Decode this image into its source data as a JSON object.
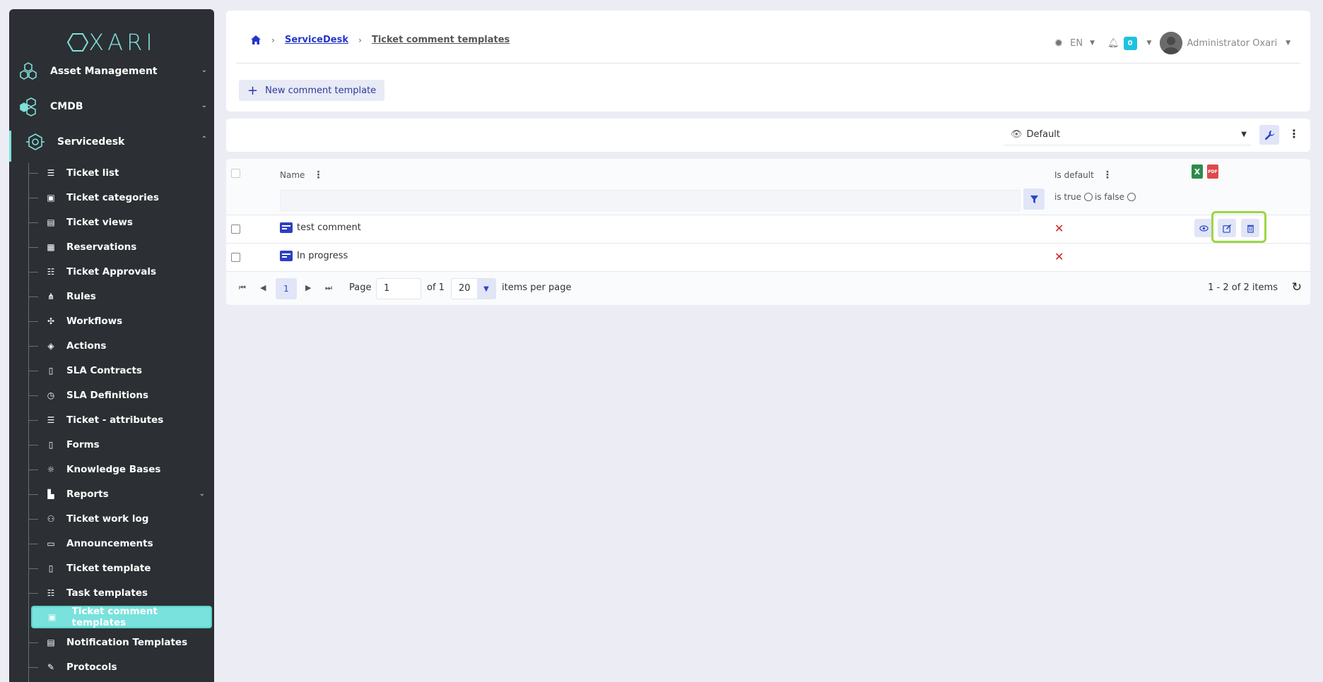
{
  "brand": {
    "logo_text": "XARI",
    "logo_prefix": "O"
  },
  "sidebar": {
    "main_items": [
      {
        "label": "Asset Management",
        "icon": "molecule-icon"
      },
      {
        "label": "CMDB",
        "icon": "hexagon-cluster-icon"
      },
      {
        "label": "Servicedesk",
        "icon": "servicedesk-icon"
      }
    ],
    "sub_items": [
      {
        "label": "Ticket list",
        "icon": "list-icon"
      },
      {
        "label": "Ticket categories",
        "icon": "categories-icon"
      },
      {
        "label": "Ticket views",
        "icon": "table-icon"
      },
      {
        "label": "Reservations",
        "icon": "calendar-icon"
      },
      {
        "label": "Ticket Approvals",
        "icon": "checklist-icon"
      },
      {
        "label": "Rules",
        "icon": "rules-icon"
      },
      {
        "label": "Workflows",
        "icon": "workflow-icon"
      },
      {
        "label": "Actions",
        "icon": "actions-icon"
      },
      {
        "label": "SLA Contracts",
        "icon": "document-icon"
      },
      {
        "label": "SLA Definitions",
        "icon": "stopwatch-icon"
      },
      {
        "label": "Ticket - attributes",
        "icon": "list-icon"
      },
      {
        "label": "Forms",
        "icon": "document-icon"
      },
      {
        "label": "Knowledge Bases",
        "icon": "lightbulb-icon"
      },
      {
        "label": "Reports",
        "icon": "chart-icon"
      },
      {
        "label": "Ticket work log",
        "icon": "user-clock-icon"
      },
      {
        "label": "Announcements",
        "icon": "announcement-icon"
      },
      {
        "label": "Ticket template",
        "icon": "document-icon"
      },
      {
        "label": "Task templates",
        "icon": "checklist-icon"
      },
      {
        "label": "Ticket comment templates",
        "icon": "comment-template-icon"
      },
      {
        "label": "Notification Templates",
        "icon": "notification-template-icon"
      },
      {
        "label": "Protocols",
        "icon": "protocol-icon"
      }
    ]
  },
  "header": {
    "breadcrumb": {
      "section": "ServiceDesk",
      "current": "Ticket comment templates"
    },
    "language": "EN",
    "notification_count": "0",
    "user_name": "Administrator Oxari",
    "new_button_label": "New comment template"
  },
  "view_bar": {
    "selected_view": "Default"
  },
  "table": {
    "columns": {
      "name": "Name",
      "is_default": "Is default"
    },
    "filter": {
      "is_true": "is true",
      "is_false": "is false"
    },
    "export": {
      "excel": "X",
      "pdf": "PDF"
    },
    "rows": [
      {
        "name": "test comment",
        "is_default": "✕"
      },
      {
        "name": "In progress",
        "is_default": "✕"
      }
    ]
  },
  "pager": {
    "current_page": "1",
    "page_label": "Page",
    "page_value": "1",
    "of_label": "of 1",
    "per_page": "20",
    "per_page_label": "items per page",
    "count_text": "1 - 2 of 2 items"
  },
  "colors": {
    "accent": "#79e2dc",
    "primary": "#2536c9",
    "sidebar": "#2c2f33",
    "highlight": "#9cd646",
    "danger": "#d81e1e"
  }
}
